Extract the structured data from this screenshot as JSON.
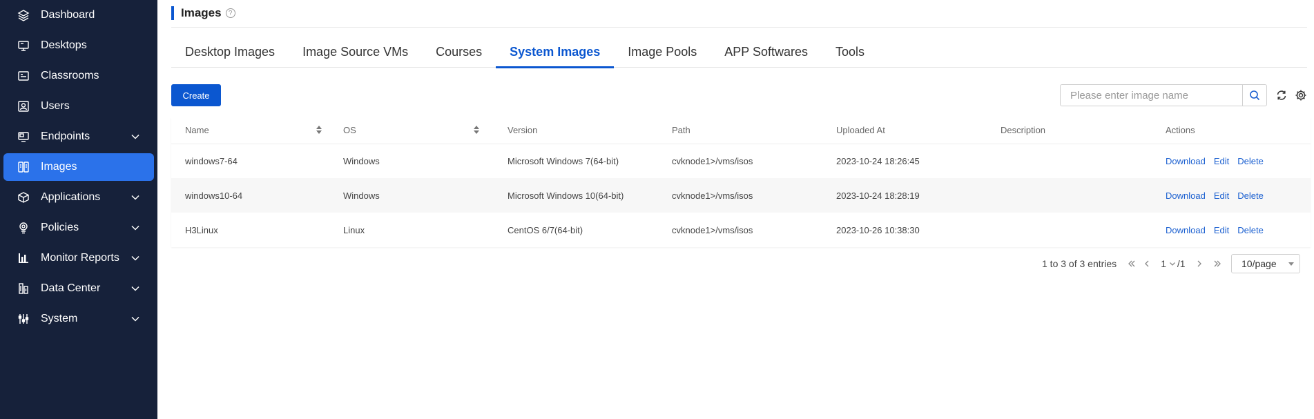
{
  "sidebar": {
    "items": [
      {
        "label": "Dashboard",
        "icon": "layers-icon"
      },
      {
        "label": "Desktops",
        "icon": "desktop-icon"
      },
      {
        "label": "Classrooms",
        "icon": "classroom-icon"
      },
      {
        "label": "Users",
        "icon": "user-icon"
      },
      {
        "label": "Endpoints",
        "icon": "endpoint-icon",
        "expandable": true
      },
      {
        "label": "Images",
        "icon": "images-icon",
        "active": true
      },
      {
        "label": "Applications",
        "icon": "box-icon",
        "expandable": true
      },
      {
        "label": "Policies",
        "icon": "policy-icon",
        "expandable": true
      },
      {
        "label": "Monitor Reports",
        "icon": "bar-chart-icon",
        "expandable": true
      },
      {
        "label": "Data Center",
        "icon": "building-icon",
        "expandable": true
      },
      {
        "label": "System",
        "icon": "sliders-icon",
        "expandable": true
      }
    ]
  },
  "header": {
    "title": "Images",
    "help": "?"
  },
  "tabs": [
    {
      "label": "Desktop Images"
    },
    {
      "label": "Image Source VMs"
    },
    {
      "label": "Courses"
    },
    {
      "label": "System Images",
      "active": true
    },
    {
      "label": "Image Pools"
    },
    {
      "label": "APP Softwares"
    },
    {
      "label": "Tools"
    }
  ],
  "toolbar": {
    "create_label": "Create",
    "search_placeholder": "Please enter image name"
  },
  "table": {
    "columns": [
      "Name",
      "OS",
      "Version",
      "Path",
      "Uploaded At",
      "Description",
      "Actions"
    ],
    "rows": [
      {
        "name": "windows7-64",
        "os": "Windows",
        "version": "Microsoft Windows 7(64-bit)",
        "path": "cvknode1>/vms/isos",
        "uploaded": "2023-10-24 18:26:45",
        "description": ""
      },
      {
        "name": "windows10-64",
        "os": "Windows",
        "version": "Microsoft Windows 10(64-bit)",
        "path": "cvknode1>/vms/isos",
        "uploaded": "2023-10-24 18:28:19",
        "description": ""
      },
      {
        "name": "H3Linux",
        "os": "Linux",
        "version": "CentOS 6/7(64-bit)",
        "path": "cvknode1>/vms/isos",
        "uploaded": "2023-10-26 10:38:30",
        "description": ""
      }
    ],
    "actions": {
      "download": "Download",
      "edit": "Edit",
      "delete": "Delete"
    }
  },
  "pagination": {
    "summary": "1 to 3 of 3 entries",
    "current": "1",
    "total": "/1",
    "page_size": "10/page"
  },
  "colors": {
    "sidebar_bg": "#16213a",
    "active_bg": "#2b72ea",
    "accent": "#0b57d0",
    "link": "#1a5fd0"
  }
}
